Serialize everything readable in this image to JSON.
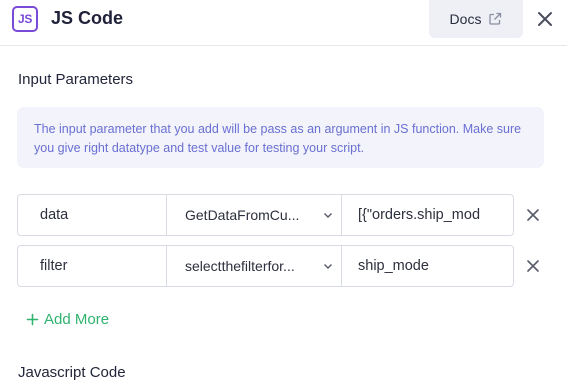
{
  "header": {
    "badge_text": "JS",
    "title": "JS Code",
    "docs_label": "Docs",
    "docs_icon": "external-link-icon",
    "close_icon": "close-icon"
  },
  "input_parameters": {
    "heading": "Input Parameters",
    "info_text": "The input parameter that you add will be pass as an argument in JS function. Make sure you give right datatype and test value for testing your script.",
    "rows": [
      {
        "name": "data",
        "source": "GetDataFromCu...",
        "value": "[{\"orders.ship_mod"
      },
      {
        "name": "filter",
        "source": "selectthefilterfor...",
        "value": "ship_mode"
      }
    ],
    "add_more_label": "Add More"
  },
  "javascript_code": {
    "heading": "Javascript Code"
  },
  "colors": {
    "brand_purple": "#7a4ad8",
    "info_text": "#6a6fd2",
    "info_bg": "#f2f3fb",
    "add_green": "#2fb36f"
  }
}
